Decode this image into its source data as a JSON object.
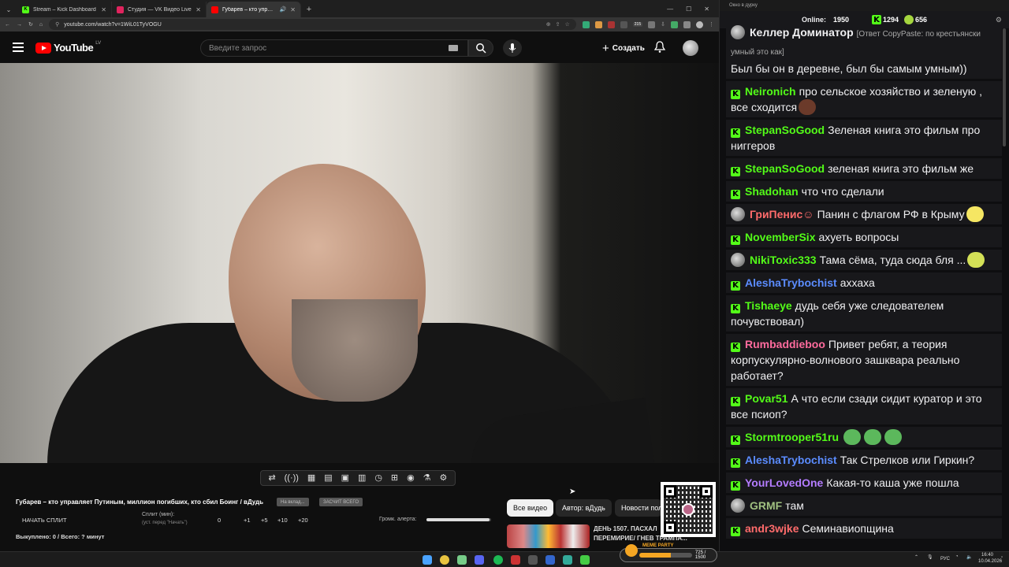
{
  "browser": {
    "tabs": [
      {
        "title": "Stream – Kick Dashboard",
        "fav": "K",
        "color": "#53fc18",
        "active": false
      },
      {
        "title": "Студия — VK Видео Live",
        "fav": "",
        "color": "#e0245e",
        "active": false
      },
      {
        "title": "Губарев – кто управляет П",
        "fav": "",
        "color": "#ff0000",
        "active": true
      }
    ],
    "url": "youtube.com/watch?v=1WiL01TyVOGU",
    "ext_badge": "215"
  },
  "youtube": {
    "logo": "YouTube",
    "region": "LV",
    "search_placeholder": "Введите запрос",
    "create_label": "Создать"
  },
  "player": {
    "control_icons": [
      "⇄",
      "((·))",
      "▦",
      "▤",
      "▣",
      "▥",
      "◷",
      "⊞",
      "◉",
      "⚗",
      "⚙"
    ]
  },
  "panel": {
    "video_title": "Губарев – кто управляет Путиным, миллион погибших, кто сбил Боинг / вДудь",
    "pill1": "На вклад...",
    "pill2": "ЗАСЧИТ ВСЕГО",
    "start_split": "НАЧАТЬ СПЛИТ",
    "split_label": "Сплит (мин):",
    "split_hint": "(уст. перед \"Начать\")",
    "split_value": "0",
    "steps": [
      "+1",
      "+5",
      "+10",
      "+20"
    ],
    "alert_volume_label": "Громк. алерта:",
    "alert_volume": 0.98,
    "paid": "Выкуплено: 0 / Всего: ? минут",
    "chips": [
      "Все видео",
      "Автор: вДудь",
      "Новости пол"
    ],
    "rec_title": "ДЕНЬ 1507. ПАСХАЛ",
    "rec_sub": "ПЕРЕМИРИЕ/ ГНЕВ ТРАМПА..."
  },
  "chat": {
    "window_title": "Окно в дурку",
    "online_label": "Online:",
    "online": "1950",
    "kick_count": "1294",
    "other_count": "656",
    "messages": [
      {
        "user": "Келлер Доминатор",
        "color": "#efeff1",
        "avatar": true,
        "reply": "[Ответ CopyPaste: по крестьянски умный это как]",
        "text": "Был бы он в деревне, был бы самым умным))"
      },
      {
        "user": "Neironich",
        "color": "#53fc18",
        "badge": true,
        "text": "про сельское хозяйство и зеленую , все сходится",
        "emote": "#6b3a2a"
      },
      {
        "user": "StepanSoGood",
        "color": "#53fc18",
        "badge": true,
        "text": "Зеленая книга это фильм про ниггеров"
      },
      {
        "user": "StepanSoGood",
        "color": "#53fc18",
        "badge": true,
        "text": "зеленая книга это фильм же"
      },
      {
        "user": "Shadohan",
        "color": "#53fc18",
        "badge": true,
        "text": "что что сделали"
      },
      {
        "user": "ГриПенис☺",
        "color": "#ff6b6b",
        "avatar": true,
        "text": "Панин с флагом РФ в Крыму",
        "emote": "#f5e663"
      },
      {
        "user": "NovemberSix",
        "color": "#53fc18",
        "badge": true,
        "text": "ахуеть вопросы"
      },
      {
        "user": "NikiToxic333",
        "color": "#53fc18",
        "avatar": true,
        "text": "Тама сёма, туда сюда бля ...",
        "emote": "#d4e157"
      },
      {
        "user": "AleshaTrybochist",
        "color": "#5b8cff",
        "badge": true,
        "text": "аххаха"
      },
      {
        "user": "Tishaeye",
        "color": "#53fc18",
        "badge": true,
        "text": "дудь себя уже следователем почувствовал)"
      },
      {
        "user": "Rumbaddieboo",
        "color": "#ff6b9d",
        "badge": true,
        "text": "Привет ребят, а теория корпускулярно-волнового зашквара реально работает?"
      },
      {
        "user": "Povar51",
        "color": "#53fc18",
        "badge": true,
        "text": "А что если сзади сидит куратор и это все псиоп?"
      },
      {
        "user": "Stormtrooper51ru",
        "color": "#53fc18",
        "badge": true,
        "text": "",
        "emotes": 3
      },
      {
        "user": "AleshaTrybochist",
        "color": "#5b8cff",
        "badge": true,
        "text": "Так Стрелков или Гиркин?"
      },
      {
        "user": "YourLovedOne",
        "color": "#b47cff",
        "badge": true,
        "text": "Какая-то каша уже пошла"
      },
      {
        "user": "GRMF",
        "color": "#a0c080",
        "avatar": true,
        "text": "там"
      },
      {
        "user": "andr3wjke",
        "color": "#ff6b6b",
        "badge": true,
        "text": "Семинавиопщина"
      }
    ]
  },
  "taskbar": {
    "meme_label": "MEME PARTY",
    "meme_value": "725 / 1500",
    "lang": "РУС",
    "time": "16:40",
    "date": "10.04.2026"
  }
}
